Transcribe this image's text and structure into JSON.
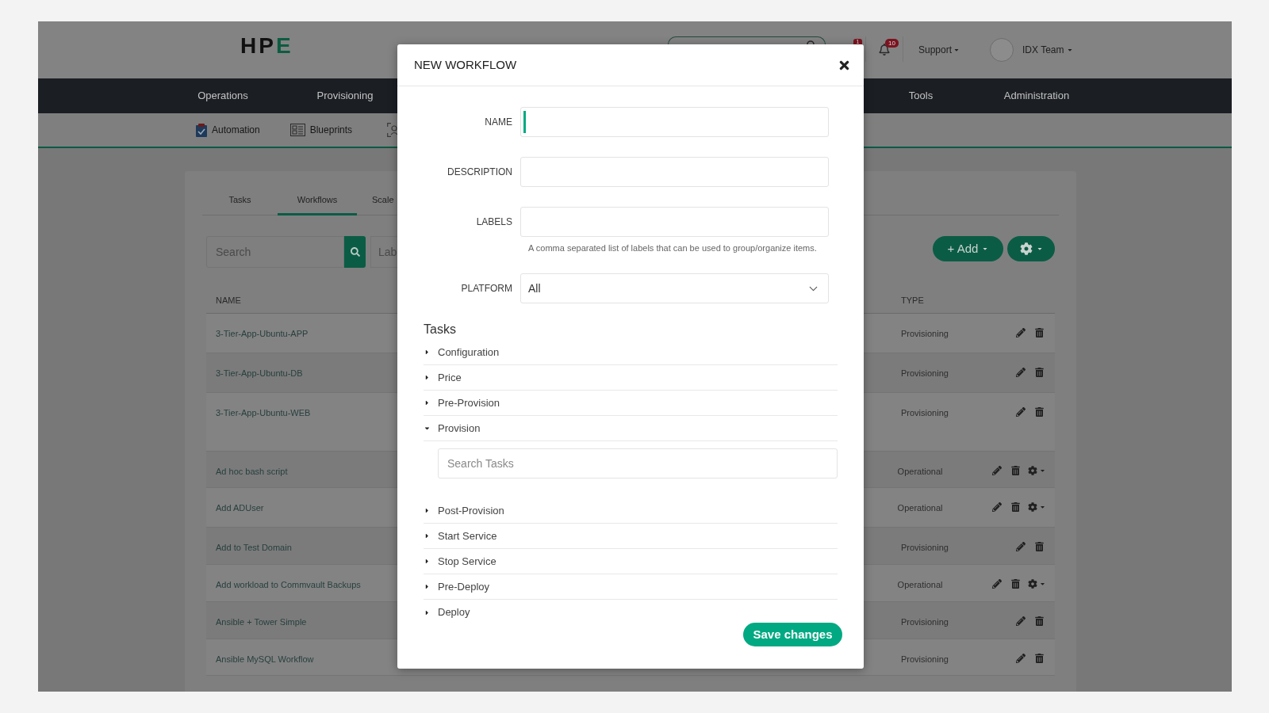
{
  "header": {
    "logo": "HPE",
    "badges": [
      "1",
      "10"
    ],
    "support_menu": "Support",
    "user_menu": "IDX Team"
  },
  "nav": {
    "items": [
      "Operations",
      "Provisioning",
      "Tools",
      "Administration"
    ]
  },
  "subnav": {
    "items": [
      "Automation",
      "Blueprints"
    ]
  },
  "tabs": [
    {
      "label": "Tasks",
      "selected": false
    },
    {
      "label": "Workflows",
      "selected": true
    },
    {
      "label": "Scale",
      "selected": false
    }
  ],
  "toolbar": {
    "search": {
      "placeholder": "Search"
    },
    "labels_filter": {
      "placeholder": "Lab"
    },
    "add_button": "+ Add"
  },
  "table": {
    "columns": [
      "NAME",
      "TYPE"
    ],
    "rows": [
      {
        "name": "3-Tier-App-Ubuntu-APP",
        "type": "Provisioning",
        "settings_menu": false
      },
      {
        "name": "3-Tier-App-Ubuntu-DB",
        "type": "Provisioning",
        "settings_menu": false
      },
      {
        "name": "3-Tier-App-Ubuntu-WEB",
        "type": "Provisioning",
        "settings_menu": false
      },
      {
        "name": "Ad hoc bash script",
        "type": "Operational",
        "settings_menu": true
      },
      {
        "name": "Add ADUser",
        "type": "Operational",
        "settings_menu": true
      },
      {
        "name": "Add to Test Domain",
        "type": "Provisioning",
        "settings_menu": false
      },
      {
        "name": "Add workload to Commvault Backups",
        "type": "Operational",
        "settings_menu": true
      },
      {
        "name": "Ansible + Tower Simple",
        "type": "Provisioning",
        "settings_menu": false
      },
      {
        "name": "Ansible MySQL Workflow",
        "type": "Provisioning",
        "settings_menu": false
      }
    ]
  },
  "modal": {
    "title": "NEW WORKFLOW",
    "fields": [
      {
        "label": "NAME",
        "kind": "text",
        "focused": true
      },
      {
        "label": "DESCRIPTION",
        "kind": "text",
        "focused": false
      },
      {
        "label": "LABELS",
        "kind": "text",
        "focused": false,
        "help": "A comma separated list of labels that can be used to group/organize items."
      },
      {
        "label": "PLATFORM",
        "kind": "select",
        "focused": false,
        "value": "All"
      }
    ],
    "tasks": {
      "title": "Tasks",
      "sections": [
        {
          "label": "Configuration",
          "expanded": false
        },
        {
          "label": "Price",
          "expanded": false
        },
        {
          "label": "Pre-Provision",
          "expanded": false
        },
        {
          "label": "Provision",
          "expanded": true,
          "search": {
            "placeholder": "Search Tasks"
          }
        },
        {
          "label": "Post-Provision",
          "expanded": false
        },
        {
          "label": "Start Service",
          "expanded": false
        },
        {
          "label": "Stop Service",
          "expanded": false
        },
        {
          "label": "Pre-Deploy",
          "expanded": false
        },
        {
          "label": "Deploy",
          "expanded": false
        }
      ]
    },
    "save_button": "Save changes"
  }
}
